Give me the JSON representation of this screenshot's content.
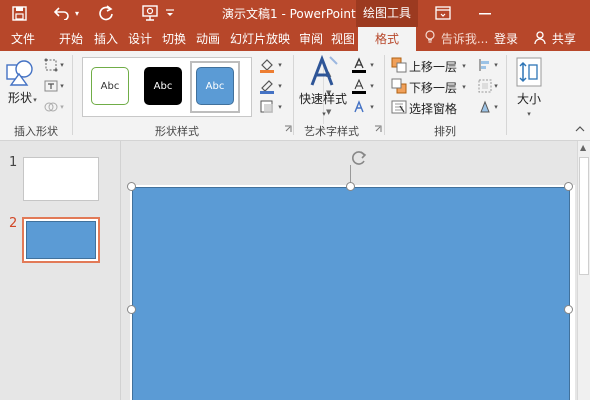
{
  "title_bar": {
    "title": "演示文稿1 - PowerPoint",
    "context_tab": "绘图工具",
    "icons": [
      "save-icon",
      "undo-icon",
      "redo-icon",
      "slideshow-icon",
      "customize-qat-icon",
      "ribbon-options-icon",
      "minimize-icon"
    ]
  },
  "tabs": [
    {
      "label": "文件"
    },
    {
      "label": "开始"
    },
    {
      "label": "插入"
    },
    {
      "label": "设计"
    },
    {
      "label": "切换"
    },
    {
      "label": "动画"
    },
    {
      "label": "幻灯片放映"
    },
    {
      "label": "审阅"
    },
    {
      "label": "视图"
    },
    {
      "label": "格式",
      "active": true
    }
  ],
  "tell_me": "告诉我...",
  "login": "登录",
  "share": "共享",
  "ribbon": {
    "insert_shapes": {
      "shape_label": "形状",
      "group_label": "插入形状"
    },
    "shape_styles": {
      "thumbs": [
        "Abc",
        "Abc",
        "Abc"
      ],
      "group_label": "形状样式"
    },
    "wordart": {
      "quick_styles_label": "快速样式",
      "group_label": "艺术字样式"
    },
    "arrange": {
      "bring_forward": "上移一层",
      "send_backward": "下移一层",
      "selection_pane": "选择窗格",
      "group_label": "排列"
    },
    "size": {
      "label": "大小"
    }
  },
  "slides": [
    {
      "number": "1"
    },
    {
      "number": "2",
      "selected": true
    }
  ],
  "colors": {
    "accent": "#b7472a",
    "shape_fill": "#5b9bd5",
    "selection": "#d24726"
  }
}
